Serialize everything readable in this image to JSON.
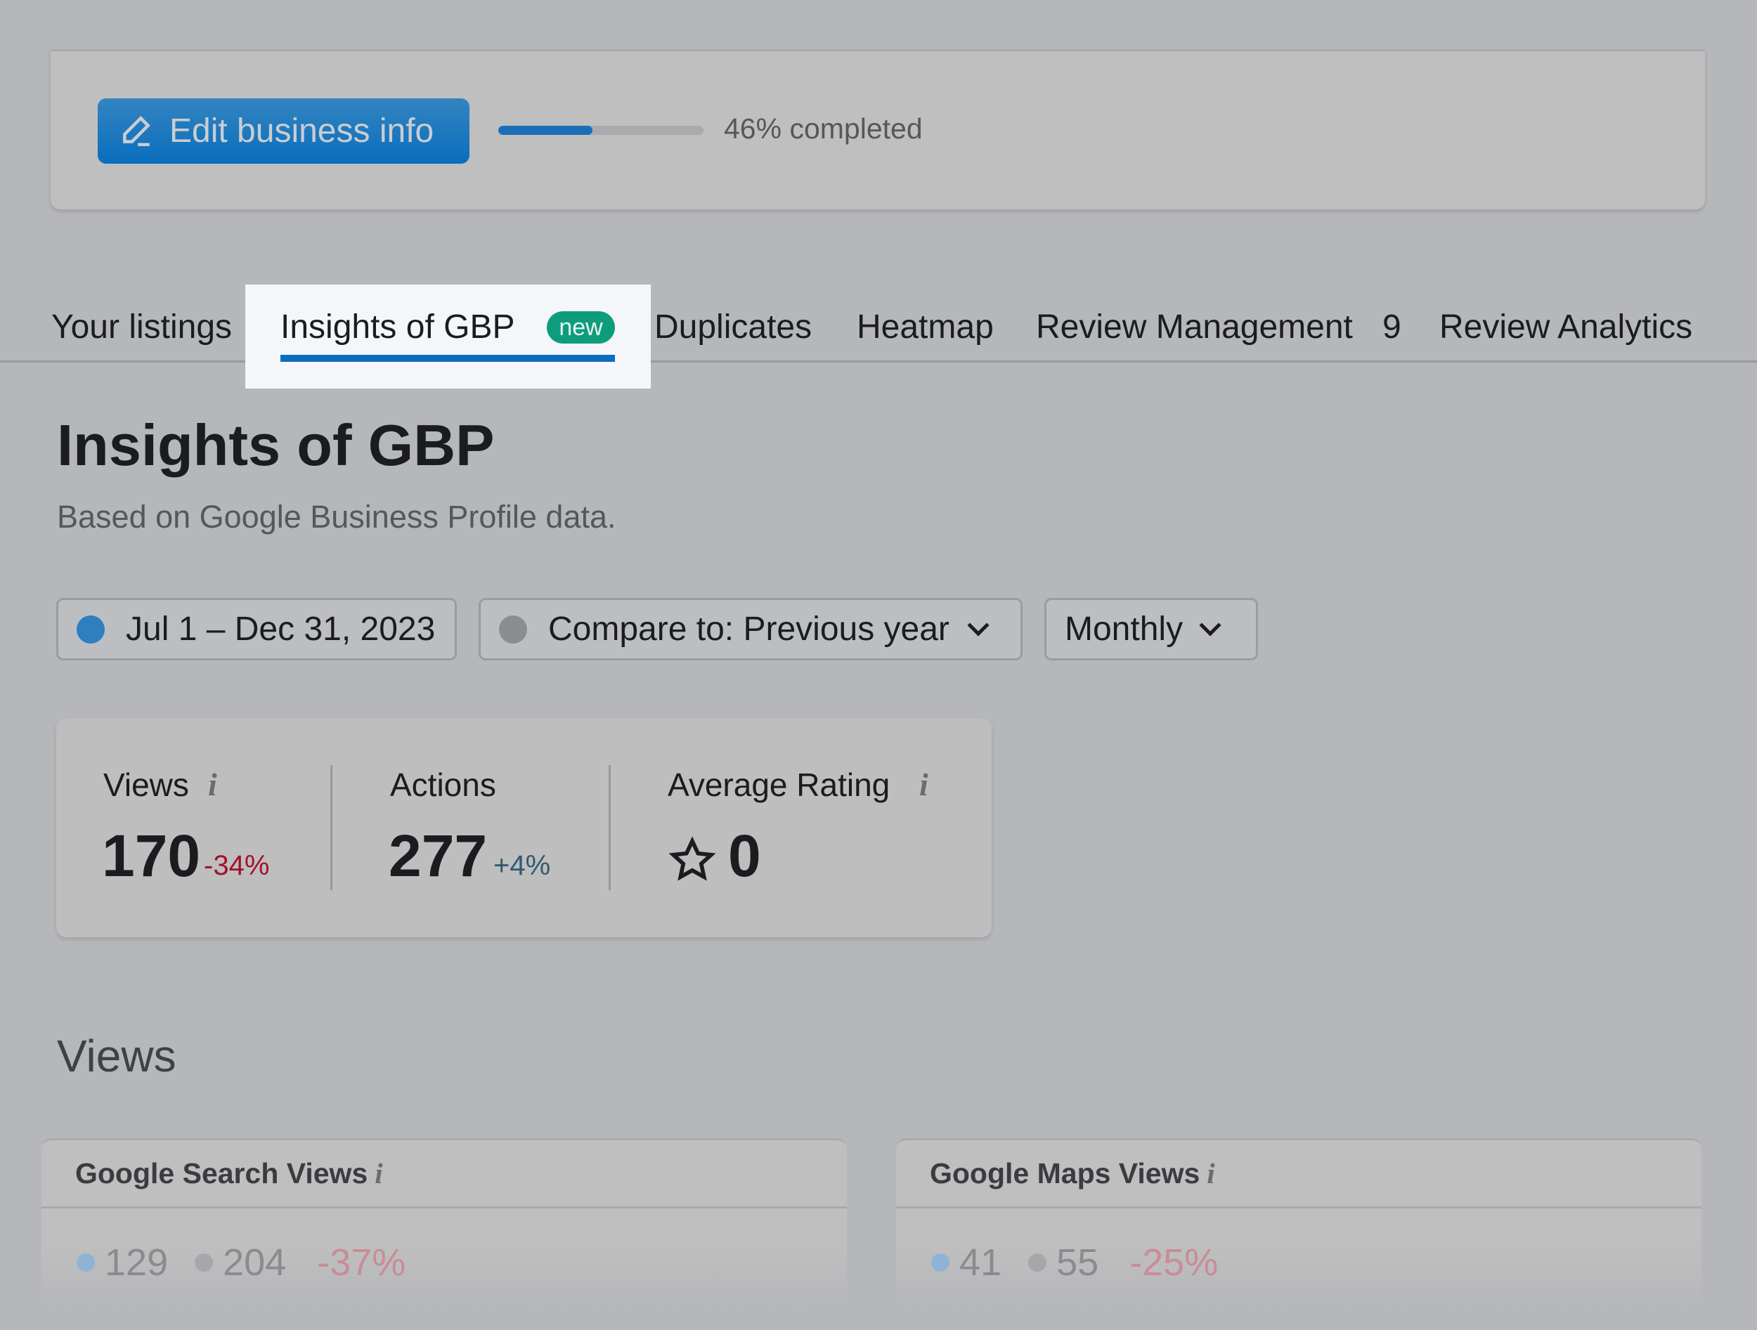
{
  "top": {
    "edit_label": "Edit business info",
    "progress_percent": 46,
    "progress_text": "46% completed"
  },
  "tabs": [
    {
      "label": "Your listings"
    },
    {
      "label": "Insights of GBP",
      "badge": "new",
      "active": true
    },
    {
      "label": "Duplicates"
    },
    {
      "label": "Heatmap"
    },
    {
      "label": "Review Management",
      "count": "9"
    },
    {
      "label": "Review Analytics"
    }
  ],
  "page": {
    "title": "Insights of GBP",
    "subtitle": "Based on Google Business Profile data."
  },
  "filters": {
    "date_range": "Jul 1 – Dec 31, 2023",
    "compare": "Compare to: Previous year",
    "period": "Monthly"
  },
  "stats": [
    {
      "label": "Views",
      "value": "170",
      "change": "-34%"
    },
    {
      "label": "Actions",
      "value": "277",
      "change": "+4%"
    },
    {
      "label": "Average Rating",
      "value": "0"
    }
  ],
  "views_section": {
    "heading": "Views",
    "cards": [
      {
        "title": "Google Search Views",
        "current": "129",
        "previous": "204",
        "change": "-37%"
      },
      {
        "title": "Google Maps Views",
        "current": "41",
        "previous": "55",
        "change": "-25%"
      }
    ]
  },
  "colors": {
    "accent": "#0a6ebd",
    "badge": "#0e9d7c",
    "negative": "#a3112a",
    "positive": "#2f5b6f"
  }
}
